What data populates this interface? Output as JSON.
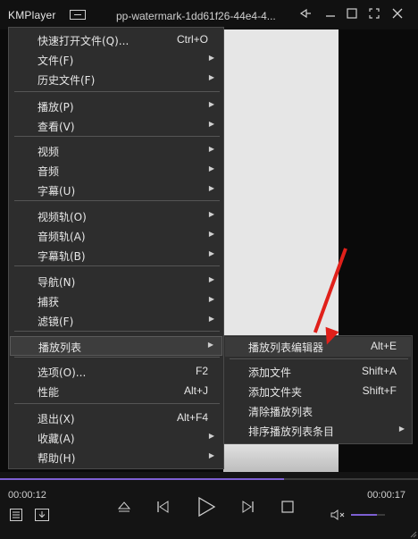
{
  "app": {
    "logo": "KMPlayer",
    "window_title": "pp-watermark-1dd61f26-44e4-4..."
  },
  "titlebar": {
    "pin_icon": "pin-icon",
    "minimize_icon": "minimize-icon",
    "maximize_icon": "maximize-icon",
    "fullscreen_icon": "fullscreen-icon",
    "close_icon": "close-icon"
  },
  "menu": {
    "items": [
      {
        "label": "快速打开文件(Q)...",
        "shortcut": "Ctrl+O",
        "submenu": false
      },
      {
        "label": "文件(F)",
        "shortcut": "",
        "submenu": true
      },
      {
        "label": "历史文件(F)",
        "shortcut": "",
        "submenu": true
      },
      {
        "label": "播放(P)",
        "shortcut": "",
        "submenu": true
      },
      {
        "label": "查看(V)",
        "shortcut": "",
        "submenu": true
      },
      {
        "label": "视频",
        "shortcut": "",
        "submenu": true
      },
      {
        "label": "音频",
        "shortcut": "",
        "submenu": true
      },
      {
        "label": "字幕(U)",
        "shortcut": "",
        "submenu": true
      },
      {
        "label": "视频轨(O)",
        "shortcut": "",
        "submenu": true
      },
      {
        "label": "音频轨(A)",
        "shortcut": "",
        "submenu": true
      },
      {
        "label": "字幕轨(B)",
        "shortcut": "",
        "submenu": true
      },
      {
        "label": "导航(N)",
        "shortcut": "",
        "submenu": true
      },
      {
        "label": "捕获",
        "shortcut": "",
        "submenu": true
      },
      {
        "label": "滤镜(F)",
        "shortcut": "",
        "submenu": true
      },
      {
        "label": "播放列表",
        "shortcut": "",
        "submenu": true,
        "highlighted": true
      },
      {
        "label": "选项(O)...",
        "shortcut": "F2",
        "submenu": false
      },
      {
        "label": "性能",
        "shortcut": "Alt+J",
        "submenu": false
      },
      {
        "label": "退出(X)",
        "shortcut": "Alt+F4",
        "submenu": false
      },
      {
        "label": "收藏(A)",
        "shortcut": "",
        "submenu": true
      },
      {
        "label": "帮助(H)",
        "shortcut": "",
        "submenu": true
      }
    ]
  },
  "submenu": {
    "items": [
      {
        "label": "播放列表编辑器",
        "shortcut": "Alt+E",
        "submenu": false,
        "highlighted": true
      },
      {
        "label": "添加文件",
        "shortcut": "Shift+A",
        "submenu": false
      },
      {
        "label": "添加文件夹",
        "shortcut": "Shift+F",
        "submenu": false
      },
      {
        "label": "清除播放列表",
        "shortcut": "",
        "submenu": false
      },
      {
        "label": "排序播放列表条目",
        "shortcut": "",
        "submenu": true
      }
    ]
  },
  "player": {
    "time_elapsed": "00:00:12",
    "time_total": "00:00:17",
    "progress_fraction": 0.68,
    "volume_fraction": 0.75
  },
  "colors": {
    "accent": "#7d5fd2",
    "annotation_arrow": "#e0201a"
  }
}
